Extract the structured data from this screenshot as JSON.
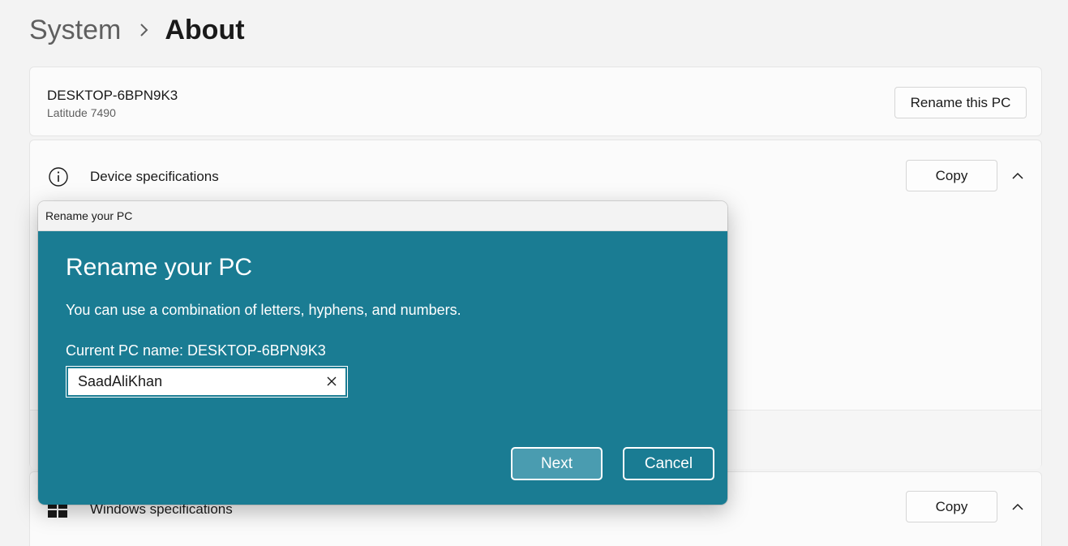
{
  "breadcrumb": {
    "parent": "System",
    "separator_icon": "chevron-right-icon",
    "current": "About"
  },
  "pc_card": {
    "name": "DESKTOP-6BPN9K3",
    "model": "Latitude 7490",
    "rename_button": "Rename this PC"
  },
  "device_specs": {
    "icon": "info-icon",
    "title": "Device specifications",
    "copy_button": "Copy",
    "expand_icon": "chevron-up-icon"
  },
  "windows_specs": {
    "icon": "windows-logo-icon",
    "title": "Windows specifications",
    "copy_button": "Copy",
    "expand_icon": "chevron-up-icon"
  },
  "dialog": {
    "window_title": "Rename your PC",
    "heading": "Rename your PC",
    "description": "You can use a combination of letters, hyphens, and numbers.",
    "current_name_text": "Current PC name: DESKTOP-6BPN9K3",
    "input_value": "SaadAliKhan",
    "clear_icon": "close-icon",
    "next_button": "Next",
    "cancel_button": "Cancel"
  },
  "colors": {
    "dialog_background": "#1a7c93",
    "next_button_background": "#4a9cb0",
    "page_background": "#f3f3f3",
    "card_background": "#fbfbfb"
  }
}
